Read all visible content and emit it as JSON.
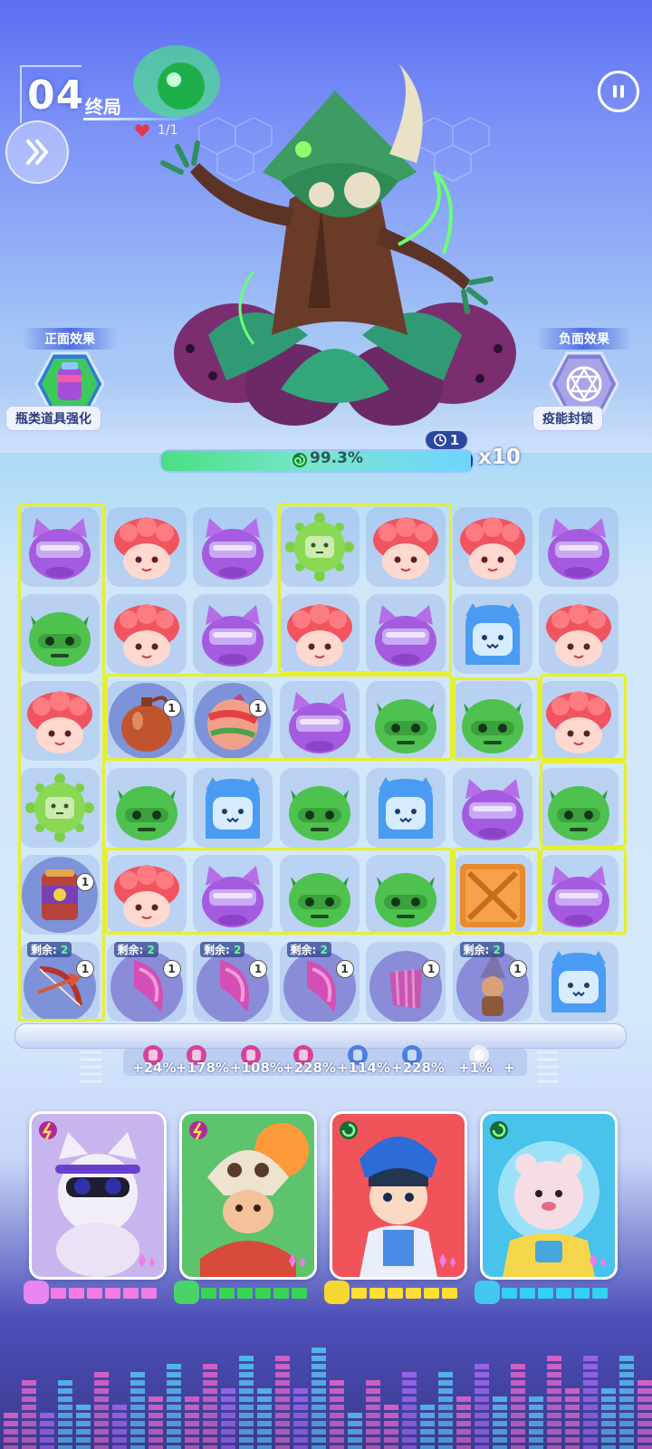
{
  "header": {
    "level": "04",
    "stage_name": "终局",
    "progress_count": "1/1"
  },
  "effects": {
    "positive_title": "正面效果",
    "positive_label": "瓶类道具强化",
    "negative_title": "负面效果",
    "negative_label": "疫能封锁"
  },
  "boss": {
    "hp_percent_text": "99.3%",
    "hp_fraction": 0.993,
    "turns": "1",
    "multiplier": "x10"
  },
  "board": {
    "remain_label": "剩余:",
    "remain_value": "2",
    "item_count": "1",
    "rows": [
      [
        "purple-cat",
        "red-curly",
        "purple-cat",
        "green-virus",
        "red-curly",
        "red-curly",
        "purple-cat"
      ],
      [
        "green-horned",
        "red-curly",
        "purple-cat",
        "red-curly",
        "purple-cat",
        "blue-ghost",
        "red-curly"
      ],
      [
        "red-curly",
        "pot-item",
        "ball-item",
        "purple-cat",
        "green-horned",
        "green-horned",
        "red-curly"
      ],
      [
        "green-virus",
        "green-horned",
        "blue-ghost",
        "green-horned",
        "blue-ghost",
        "purple-cat",
        "green-horned"
      ],
      [
        "can-item",
        "red-curly",
        "purple-cat",
        "green-horned",
        "green-horned",
        "wood-crate",
        "purple-cat"
      ],
      [
        "bow-item",
        "horn-item",
        "horn-item",
        "horn-item",
        "fan-item",
        "wizard-item",
        "blue-ghost"
      ]
    ]
  },
  "buffs": [
    "+24%",
    "+178%",
    "+108%",
    "+228%",
    "+114%",
    "+228%",
    "+1%",
    "+"
  ],
  "heroes": [
    {
      "name": "cat-dj",
      "color": "#e985f0",
      "energy_color": "#f17ce6"
    },
    {
      "name": "skull-caveman",
      "color": "#49d46a",
      "energy_color": "#36d653"
    },
    {
      "name": "blue-prince",
      "color": "#f5d730",
      "energy_color": "#ffe033"
    },
    {
      "name": "astronaut-bear",
      "color": "#44c7ef",
      "energy_color": "#33d1f2"
    }
  ],
  "colors": {
    "selection_outline": "#e7ef2c",
    "hp_bar_bg": "#1c3e8c"
  }
}
